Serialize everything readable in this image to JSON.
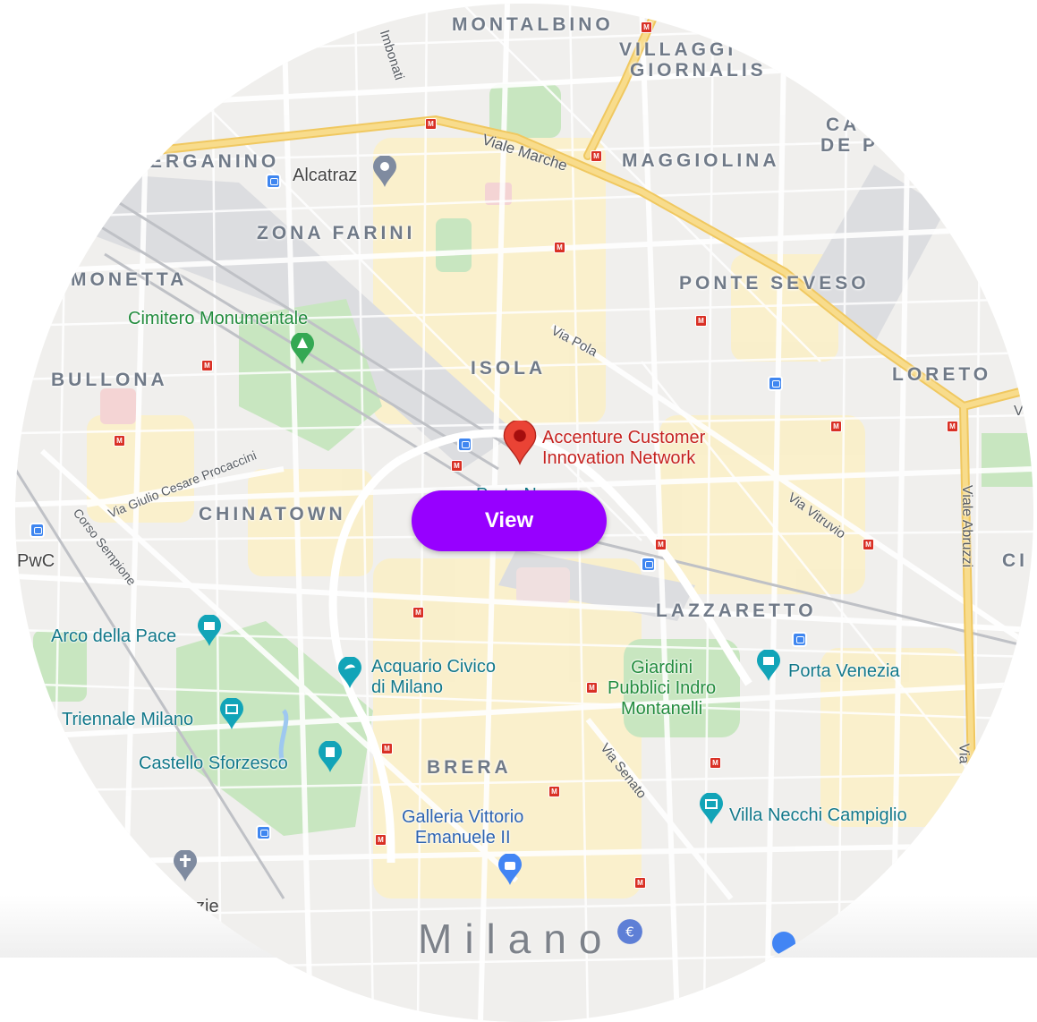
{
  "action": {
    "view_label": "View"
  },
  "main_marker": {
    "name_line1": "Accenture Customer",
    "name_line2": "Innovation Network",
    "color": "#ea4335"
  },
  "districts": {
    "montalbino": "MONTALBINO",
    "villaggio_line1": "VILLAGGI",
    "villaggio_line2": "GIORNALIS",
    "ca_line1": "CA",
    "ca_line2": "DE P",
    "berganino": "ERGANINO",
    "maggiolina": "MAGGIOLINA",
    "zona_farini": "ZONA FARINI",
    "monetta": "MONETTA",
    "ponte_seveso": "PONTE SEVESO",
    "bullona": "BULLONA",
    "isola": "ISOLA",
    "loreto": "LORETO",
    "chinatown": "CHINATOWN",
    "lazzaretto": "LAZZARETTO",
    "brera": "BRERA",
    "ci": "CI"
  },
  "streets": {
    "imbonati": "Imbonati",
    "viale_marche": "Viale Marche",
    "via_pola": "Via Pola",
    "via_giulio_cesare_procaccini": "Via Giulio Cesare Procaccini",
    "corso_sempione": "Corso Sempione",
    "via_vitruvio": "Via Vitruvio",
    "viale_abruzzi": "Viale Abruzzi",
    "via_senato": "Via Senato",
    "via_partial": "Via",
    "v_partial": "V"
  },
  "pois": {
    "alcatraz": "Alcatraz",
    "cimitero_monumentale": "Cimitero Monumentale",
    "pwc": "PwC",
    "arco_della_pace": "Arco della Pace",
    "acquario_line1": "Acquario Civico",
    "acquario_line2": "di Milano",
    "giardini_line1": "Giardini",
    "giardini_line2": "Pubblici Indro",
    "giardini_line3": "Montanelli",
    "porta_venezia": "Porta Venezia",
    "triennale_milano": "Triennale Milano",
    "castello_sforzesco": "Castello Sforzesco",
    "galleria_line1": "Galleria Vittorio",
    "galleria_line2": "Emanuele II",
    "villa_necchi": "Villa Necchi Campiglio",
    "porta_nuova_partial": "Porta N",
    "zie_partial": "zie"
  },
  "city": {
    "name": "Milano"
  },
  "colors": {
    "button": "#9700ff",
    "land": "#f0efed",
    "park": "#c8e6c0",
    "highway": "#f6d67a",
    "metro": "#d93025",
    "train": "#3f86f0"
  }
}
